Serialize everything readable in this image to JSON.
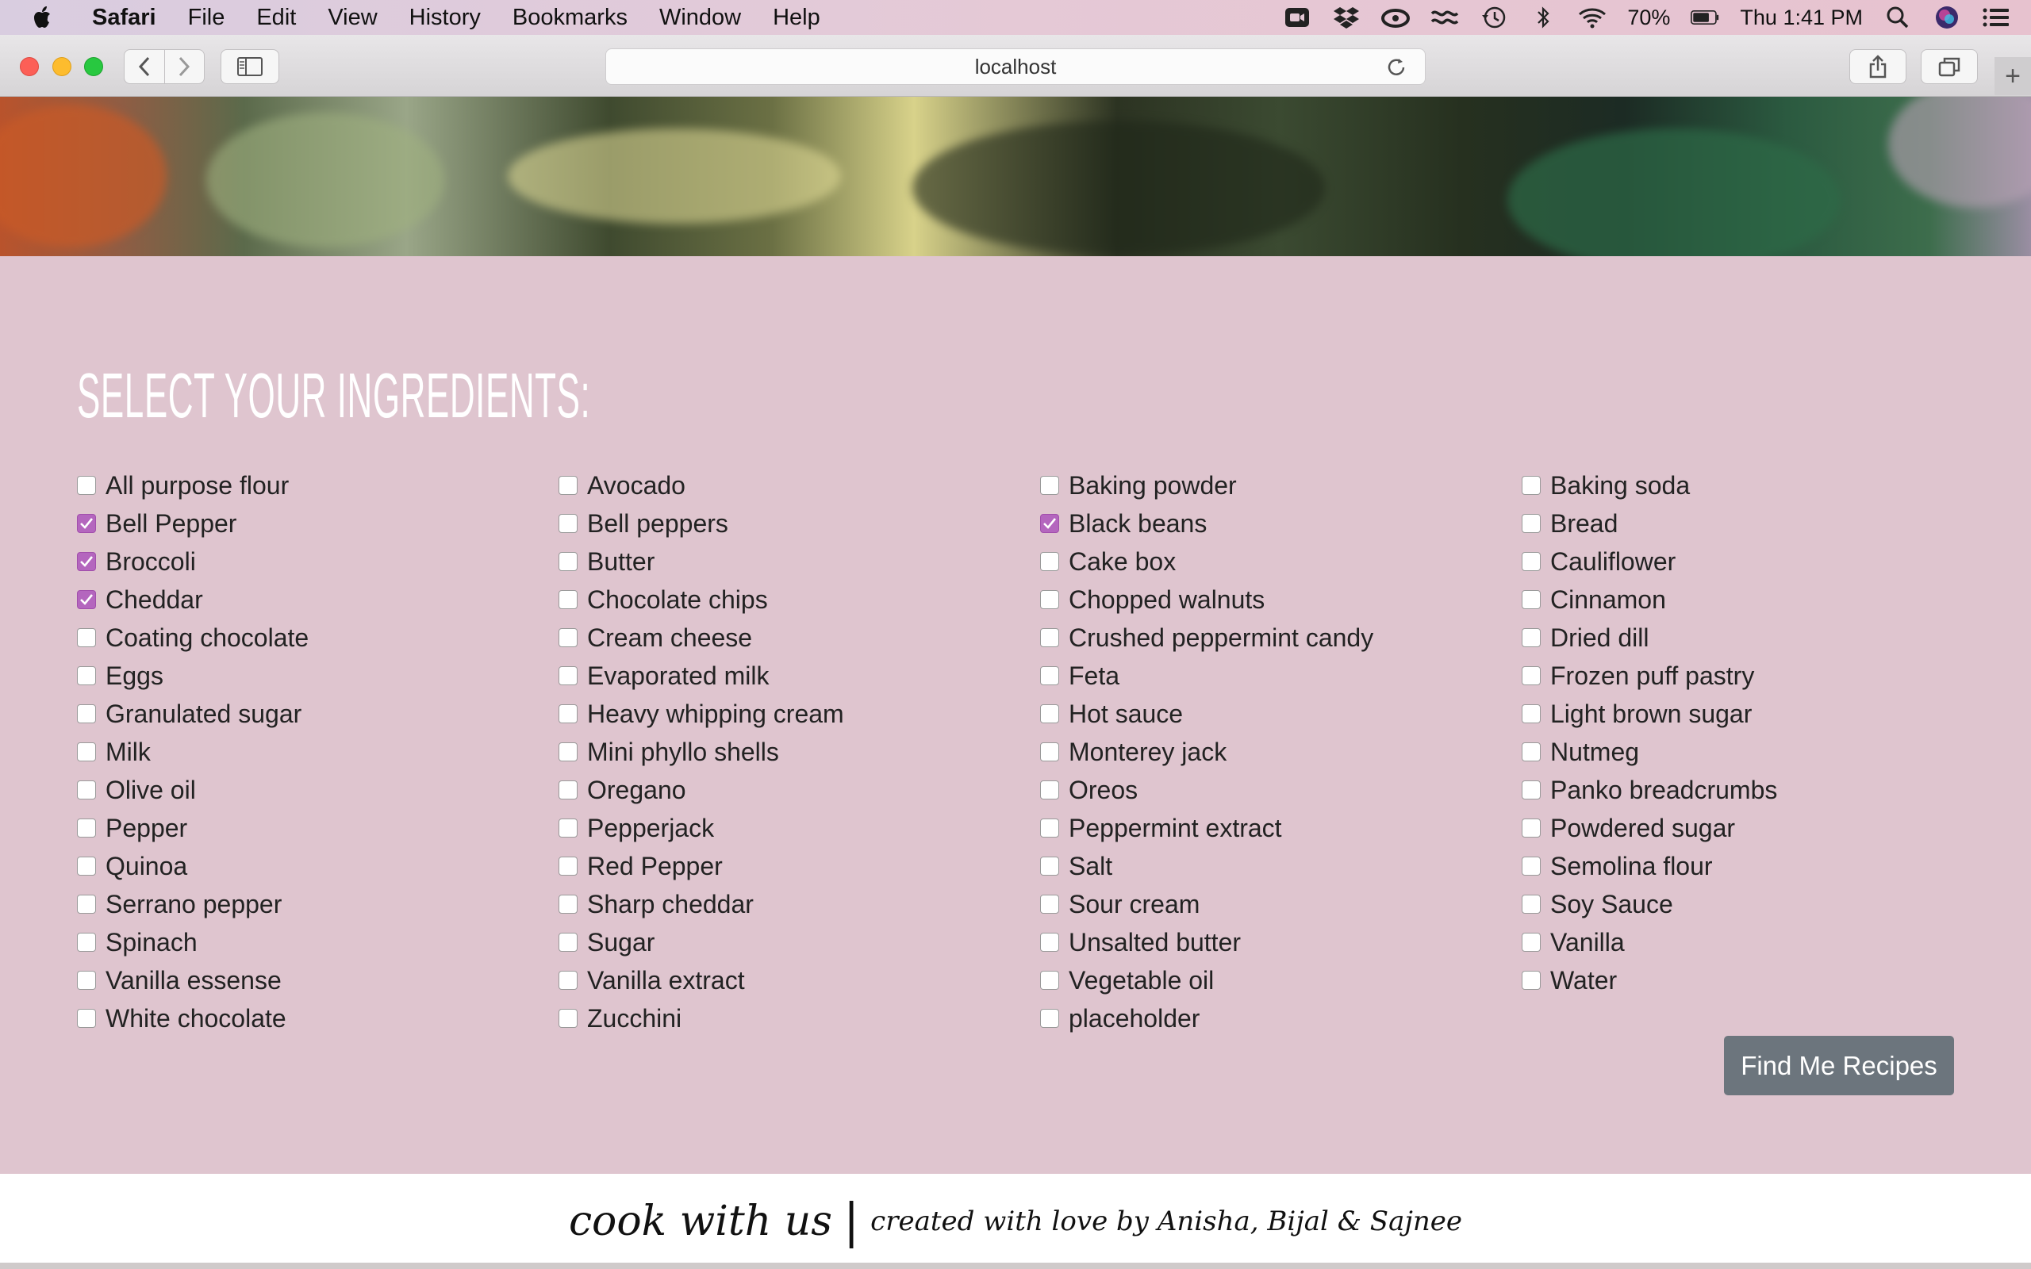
{
  "menubar": {
    "items": [
      "Safari",
      "File",
      "Edit",
      "View",
      "History",
      "Bookmarks",
      "Window",
      "Help"
    ],
    "battery": "70%",
    "clock": "Thu 1:41 PM"
  },
  "browser": {
    "url": "localhost",
    "new_tab": "+"
  },
  "page": {
    "title": "SELECT YOUR INGREDIENTS:",
    "ingredients": [
      {
        "label": "All purpose flour",
        "checked": false
      },
      {
        "label": "Bell Pepper",
        "checked": true
      },
      {
        "label": "Broccoli",
        "checked": true
      },
      {
        "label": "Cheddar",
        "checked": true
      },
      {
        "label": "Coating chocolate",
        "checked": false
      },
      {
        "label": "Eggs",
        "checked": false
      },
      {
        "label": "Granulated sugar",
        "checked": false
      },
      {
        "label": "Milk",
        "checked": false
      },
      {
        "label": "Olive oil",
        "checked": false
      },
      {
        "label": "Pepper",
        "checked": false
      },
      {
        "label": "Quinoa",
        "checked": false
      },
      {
        "label": "Serrano pepper",
        "checked": false
      },
      {
        "label": "Spinach",
        "checked": false
      },
      {
        "label": "Vanilla essense",
        "checked": false
      },
      {
        "label": "White chocolate",
        "checked": false
      },
      {
        "label": "Avocado",
        "checked": false
      },
      {
        "label": "Bell peppers",
        "checked": false
      },
      {
        "label": "Butter",
        "checked": false
      },
      {
        "label": "Chocolate chips",
        "checked": false
      },
      {
        "label": "Cream cheese",
        "checked": false
      },
      {
        "label": "Evaporated milk",
        "checked": false
      },
      {
        "label": "Heavy whipping cream",
        "checked": false
      },
      {
        "label": "Mini phyllo shells",
        "checked": false
      },
      {
        "label": "Oregano",
        "checked": false
      },
      {
        "label": "Pepperjack",
        "checked": false
      },
      {
        "label": "Red Pepper",
        "checked": false
      },
      {
        "label": "Sharp cheddar",
        "checked": false
      },
      {
        "label": "Sugar",
        "checked": false
      },
      {
        "label": "Vanilla extract",
        "checked": false
      },
      {
        "label": "Zucchini",
        "checked": false
      },
      {
        "label": "Baking powder",
        "checked": false
      },
      {
        "label": "Black beans",
        "checked": true
      },
      {
        "label": "Cake box",
        "checked": false
      },
      {
        "label": "Chopped walnuts",
        "checked": false
      },
      {
        "label": "Crushed peppermint candy",
        "checked": false
      },
      {
        "label": "Feta",
        "checked": false
      },
      {
        "label": "Hot sauce",
        "checked": false
      },
      {
        "label": "Monterey jack",
        "checked": false
      },
      {
        "label": "Oreos",
        "checked": false
      },
      {
        "label": "Peppermint extract",
        "checked": false
      },
      {
        "label": "Salt",
        "checked": false
      },
      {
        "label": "Sour cream",
        "checked": false
      },
      {
        "label": "Unsalted butter",
        "checked": false
      },
      {
        "label": "Vegetable oil",
        "checked": false
      },
      {
        "label": "placeholder",
        "checked": false
      },
      {
        "label": "Baking soda",
        "checked": false
      },
      {
        "label": "Bread",
        "checked": false
      },
      {
        "label": "Cauliflower",
        "checked": false
      },
      {
        "label": "Cinnamon",
        "checked": false
      },
      {
        "label": "Dried dill",
        "checked": false
      },
      {
        "label": "Frozen puff pastry",
        "checked": false
      },
      {
        "label": "Light brown sugar",
        "checked": false
      },
      {
        "label": "Nutmeg",
        "checked": false
      },
      {
        "label": "Panko breadcrumbs",
        "checked": false
      },
      {
        "label": "Powdered sugar",
        "checked": false
      },
      {
        "label": "Semolina flour",
        "checked": false
      },
      {
        "label": "Soy Sauce",
        "checked": false
      },
      {
        "label": "Vanilla",
        "checked": false
      },
      {
        "label": "Water",
        "checked": false
      }
    ],
    "find_button": "Find Me Recipes"
  },
  "footer": {
    "brand": "cook with us",
    "separator": "|",
    "credit": "created with love by Anisha, Bijal & Sajnee"
  },
  "colors": {
    "page_bg": "#dfc5cf",
    "checkbox_checked": "#b466be",
    "button_bg": "#6c757d"
  }
}
